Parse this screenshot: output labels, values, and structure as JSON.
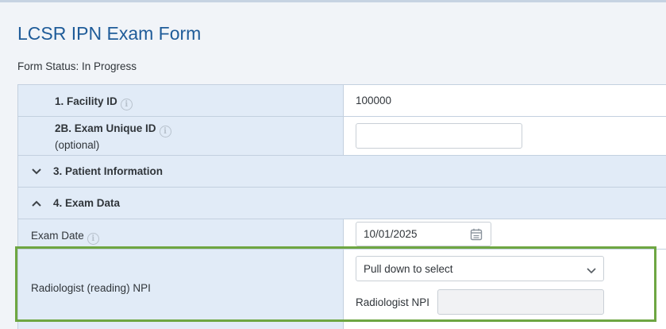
{
  "page": {
    "title": "LCSR IPN Exam Form",
    "status": "Form Status: In Progress"
  },
  "fields": {
    "facility_id": {
      "label": "1. Facility ID",
      "value": "100000"
    },
    "exam_unique_id": {
      "label": "2B. Exam Unique ID",
      "note": "(optional)",
      "value": ""
    },
    "exam_date": {
      "label": "Exam Date",
      "value": "10/01/2025"
    },
    "radiologist_npi": {
      "label": "Radiologist (reading) NPI",
      "select_value": "Pull down to select",
      "npi_label": "Radiologist NPI",
      "npi_value": ""
    }
  },
  "sections": {
    "patient_information": {
      "label": "3. Patient Information",
      "state": "collapsed"
    },
    "exam_data": {
      "label": "4. Exam Data",
      "state": "expanded"
    }
  },
  "icons": {
    "info": "info-circle-icon",
    "chevron_down": "chevron-down-icon",
    "chevron_up": "chevron-up-icon",
    "calendar": "calendar-icon"
  },
  "colors": {
    "title": "#1f5c99",
    "label_bg": "#e1ebf7",
    "border": "#c3d0df",
    "highlight": "#6ea642"
  }
}
